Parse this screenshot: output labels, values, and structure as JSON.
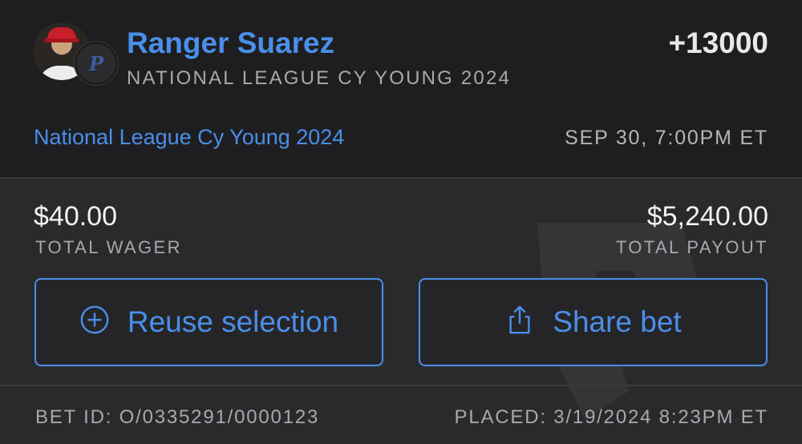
{
  "selection": {
    "player_name": "Ranger Suarez",
    "market": "NATIONAL LEAGUE CY YOUNG 2024",
    "odds": "+13000",
    "team_logo_text": "P",
    "event_name": "National League Cy Young 2024",
    "event_time": "SEP 30, 7:00PM ET"
  },
  "totals": {
    "wager_value": "$40.00",
    "wager_label": "TOTAL WAGER",
    "payout_value": "$5,240.00",
    "payout_label": "TOTAL PAYOUT"
  },
  "actions": {
    "reuse_label": "Reuse selection",
    "reuse_icon": "plus-circle-icon",
    "share_label": "Share bet",
    "share_icon": "share-icon"
  },
  "footer": {
    "bet_id": "BET ID: O/0335291/0000123",
    "placed": "PLACED: 3/19/2024 8:23PM ET"
  },
  "colors": {
    "accent": "#4a8fe9",
    "background_top": "#1e1e20",
    "background_bottom": "#2a2a2d"
  }
}
